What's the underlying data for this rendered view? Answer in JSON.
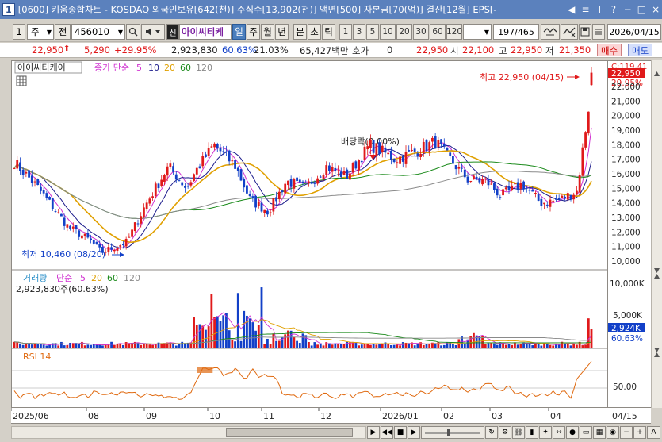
{
  "window": {
    "number": "1",
    "title": "[0600] 키움종합차트 - KOSDAQ 외국인보유[642(천)] 주식수[13,902(천)] 액면[500] 자본금[70(억)] 결산[12월] EPS[-",
    "controls": [
      "◀",
      "≡",
      "T",
      "?",
      "−",
      "□",
      "×"
    ]
  },
  "toolbar": {
    "chart_no": "1",
    "period_select": "주",
    "all_label": "전",
    "code_value": "456010",
    "market_badge": "신",
    "stock_name": "아이씨티케",
    "period_buttons": [
      "일",
      "주",
      "월",
      "년",
      "분",
      "초",
      "틱"
    ],
    "active_period": "일",
    "interval_buttons": [
      "1",
      "3",
      "5",
      "10",
      "20",
      "30",
      "60",
      "120"
    ],
    "count_value": "197",
    "count_total": "/465",
    "date_value": "2026/04/15"
  },
  "quote": {
    "price": "22,950",
    "change": "5,290",
    "change_pct": "+29.95%",
    "volume": "2,923,830",
    "vol_ratio": "60.63%",
    "turnover": "21.03%",
    "amount": "65,427백만",
    "ask_label": "호가",
    "ask_value": "0",
    "last": "22,950",
    "open_label": "시",
    "open": "22,100",
    "high_label": "고",
    "high": "22,950",
    "low_label": "저",
    "low": "21,350",
    "buy_label": "매수",
    "sell_label": "매도"
  },
  "price_panel": {
    "stock_label": "아이씨티케이",
    "ma_title": "종가 단순",
    "ma_periods": [
      "5",
      "10",
      "20",
      "60",
      "120"
    ],
    "high_annotation": "최고 22,950 (04/15)",
    "low_annotation": "최저 10,460 (08/20)",
    "dividend_annotation": "배당락(0.00%)",
    "axis_labels": [
      "22,000",
      "21,000",
      "20,000",
      "19,000",
      "18,000",
      "17,000",
      "16,000",
      "15,000",
      "14,000",
      "13,000",
      "12,000",
      "11,000",
      "10,000"
    ],
    "top_clipped_label": "C:119.41",
    "current_price_tag": "22,950",
    "current_pct_tag": "29.95%"
  },
  "volume_panel": {
    "title": "거래량",
    "ma_title": "단순",
    "ma_periods": [
      "5",
      "20",
      "60",
      "120"
    ],
    "current_text": "2,923,830주(60.63%)",
    "axis_labels": [
      "10,000K",
      "5,000K"
    ],
    "current_tag": "2,924K",
    "current_pct_tag": "60.63%"
  },
  "rsi_panel": {
    "title": "RSI 14",
    "axis_label": "50.00"
  },
  "date_axis": {
    "labels": [
      "2025/06",
      "08",
      "09",
      "10",
      "11",
      "12",
      "2026/01",
      "02",
      "03",
      "04"
    ],
    "right_label": "04/15"
  },
  "colors": {
    "up": "#e0191a",
    "down": "#1240c8",
    "ma5": "#d02fd0",
    "ma10": "#1c1c8c",
    "ma20": "#e0a000",
    "ma60": "#1a8a1a",
    "ma120": "#8a8a8a",
    "rsi": "#e06a10",
    "title_bar": "#5b81bd"
  }
}
